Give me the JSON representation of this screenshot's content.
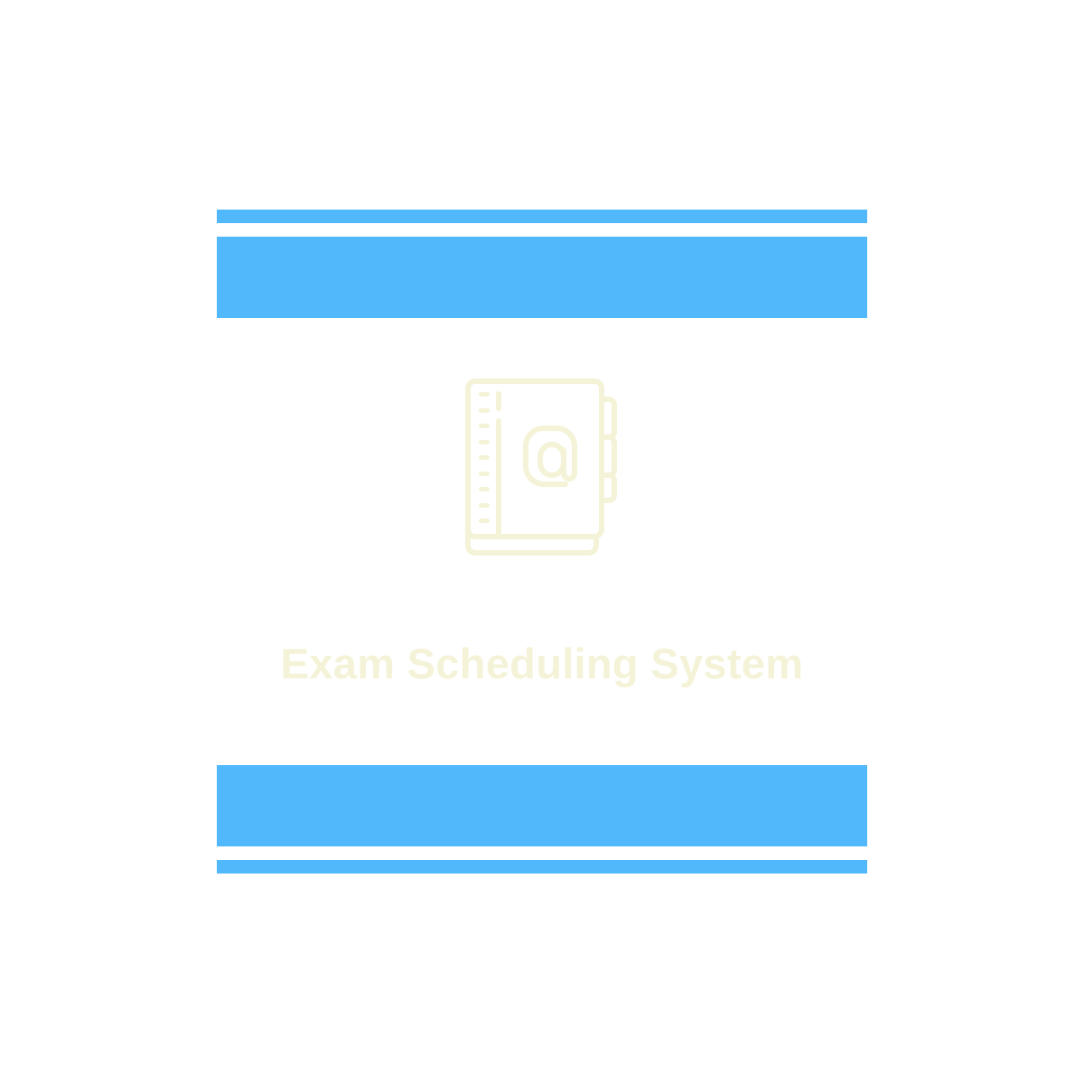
{
  "logo": {
    "title": "Exam Scheduling System",
    "icon": "address-book-at-icon"
  },
  "colors": {
    "background": "#ffffff",
    "bars": "#51b9fb",
    "logo_foreground": "#f4f3d8"
  }
}
